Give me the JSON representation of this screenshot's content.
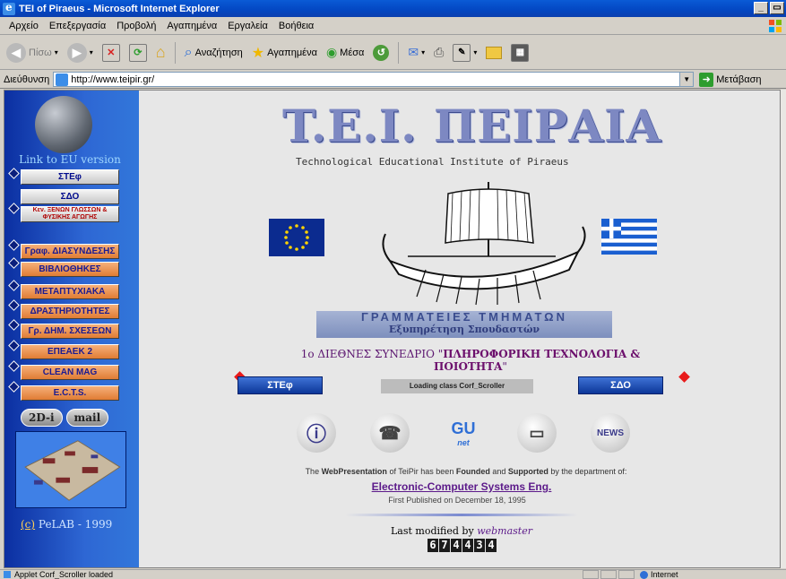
{
  "window": {
    "title": "TEI of Piraeus - Microsoft Internet Explorer",
    "minimize": "_",
    "restore": "8"
  },
  "menu": [
    "Αρχείο",
    "Επεξεργασία",
    "Προβολή",
    "Αγαπημένα",
    "Εργαλεία",
    "Βοήθεια"
  ],
  "toolbar": {
    "back": "Πίσω",
    "search": "Αναζήτηση",
    "favorites": "Αγαπημένα",
    "media": "Μέσα"
  },
  "address": {
    "label": "Διεύθυνση",
    "url": "http://www.teipir.gr/",
    "go": "Μετάβαση"
  },
  "sidebar": {
    "link_eu": "Link to EU version",
    "nav": [
      {
        "label": "ΣΤΕφ",
        "style": "grey"
      },
      {
        "label": "ΣΔΟ",
        "style": "grey"
      },
      {
        "label": "Κεν. ΞΕΝΩΝ ΓΛΩΣΣΩΝ & ΦΥΣΙΚΗΣ ΑΓΩΓΗΣ",
        "style": "small"
      },
      {
        "label": "Γραφ. ΔΙΑΣΥΝΔΕΣΗΣ",
        "style": "orange"
      },
      {
        "label": "ΒΙΒΛΙΟΘΗΚΕΣ",
        "style": "orange"
      },
      {
        "label": "ΜΕΤΑΠΤΥΧΙΑΚΑ",
        "style": "orange"
      },
      {
        "label": "ΔΡΑΣΤΗΡΙΟΤΗΤΕΣ",
        "style": "orange"
      },
      {
        "label": "Γρ. ΔΗΜ. ΣΧΕΣΕΩΝ",
        "style": "orange"
      },
      {
        "label": "ΕΠΕΑΕΚ 2",
        "style": "orange"
      },
      {
        "label": "CLEAN MAG",
        "style": "orange"
      },
      {
        "label": "E.C.T.S.",
        "style": "orange"
      }
    ],
    "pill_2di": "2D-i",
    "pill_mail": "mail",
    "pelab_c": "(c)",
    "pelab_text": " PeLAB - 1999"
  },
  "main": {
    "title": "T.E.I. ΠΕΙΡΑΙΑ",
    "subtitle": "Technological Educational Institute of Piraeus",
    "banner_line1": "ΓΡΑΜΜΑΤΕΙΕΣ ΤΜΗΜΑΤΩΝ",
    "banner_line2": "Εξυπηρέτηση Σπουδαστών",
    "conf_prefix": "1ο ΔΙΕΘΝΕΣ ΣΥΝΕΔΡΙΟ \"",
    "conf_title": "ΠΛΗΡΟΦΟΡΙΚΗ ΤΕΧΝΟΛΟΓΙΑ & ΠΟΙΟΤΗΤΑ",
    "conf_suffix": "\"",
    "btn_left": "ΣΤΕφ",
    "btn_right": "ΣΔΟ",
    "scroller": "Loading class Corf_Scroller",
    "founded_pre": "The ",
    "founded_b1": "WebPresentation",
    "founded_mid1": " of TeiPir has been ",
    "founded_b2": "Founded",
    "founded_mid2": " and ",
    "founded_b3": "Supported",
    "founded_post": " by the department of:",
    "department": "Electronic-Computer Systems Eng.",
    "first_published": "First Published on December 18, 1995",
    "last_modified": "Last modified by ",
    "webmaster": "webmaster",
    "counter": [
      "6",
      "7",
      "4",
      "4",
      "3",
      "4"
    ],
    "icons": [
      "info-icon",
      "phone-icon",
      "gunet-icon",
      "dvd-icon",
      "news-icon"
    ],
    "gunet_label": "GU",
    "gunet_sub": "net",
    "news_label": "NEWS"
  },
  "status": {
    "text": "Applet Corf_Scroller loaded",
    "zone": "Internet"
  }
}
